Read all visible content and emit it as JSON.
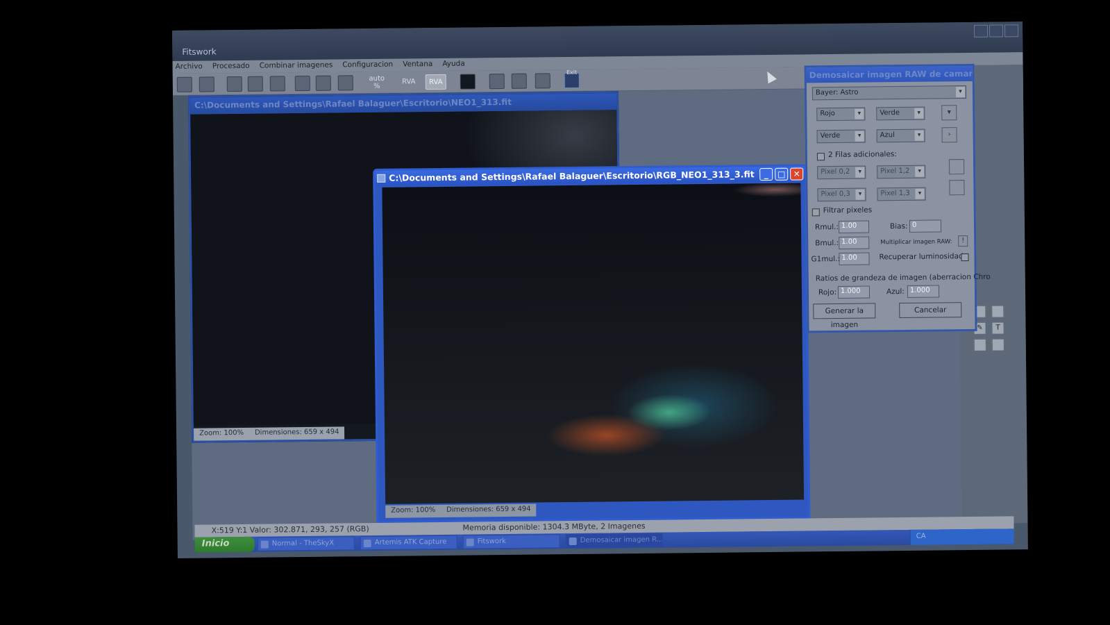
{
  "app": {
    "title": "Fitswork"
  },
  "menu": [
    "Archivo",
    "Procesado",
    "Combinar imagenes",
    "Configuracion",
    "Ventana",
    "Ayuda"
  ],
  "toolbar": {
    "auto_label": "auto\n%",
    "rva1": "RVA",
    "rva2": "RVA",
    "exit": "Exit"
  },
  "child1": {
    "title": "C:\\Documents and Settings\\Rafael Balaguer\\Escritorio\\NEO1_313.fit",
    "zoom": "Zoom: 100%",
    "dims": "Dimensiones: 659 x 494"
  },
  "child2": {
    "title": "C:\\Documents and Settings\\Rafael Balaguer\\Escritorio\\RGB_NEO1_313_3.fit",
    "zoom": "Zoom: 100%",
    "dims": "Dimensiones: 659 x 494"
  },
  "panel": {
    "title": "Demosaicar imagen RAW de camara",
    "preset": "Bayer: Astro",
    "grid": {
      "r1c1": "Rojo",
      "r1c2": "Verde",
      "r2c1": "Verde",
      "r2c2": "Azul"
    },
    "extra_rows_label": "2 Filas adicionales:",
    "pixels": {
      "p02": "Pixel 0,2",
      "p12": "Pixel 1,2",
      "p03": "Pixel 0,3",
      "p13": "Pixel 1,3"
    },
    "filter_label": "Filtrar pixeles",
    "rmul_label": "Rmul.:",
    "rmul": "1.00",
    "bias_label": "Bias:",
    "bias": "0",
    "bmul_label": "Bmul.:",
    "bmul": "1.00",
    "multiply_label": "Multiplicar imagen RAW:",
    "g1mul_label": "G1mul.:",
    "g1mul": "1.00",
    "recover_label": "Recuperar luminosidad",
    "ratios_label": "Ratios de grandeza de imagen (aberracion Chro",
    "rojo_label": "Rojo:",
    "rojo": "1.000",
    "azul_label": "Azul:",
    "azul": "1.000",
    "generate_btn": "Generar la imagen",
    "cancel_btn": "Cancelar"
  },
  "status": {
    "coords": "X:519 Y:1 Valor: 302.871, 293, 257 (RGB)",
    "memory": "Memoria disponible: 1304.3 MByte, 2 Imagenes"
  },
  "taskbar": {
    "start": "Inicio",
    "tasks": [
      "Normal - TheSkyX",
      "Artemis ATK Capture",
      "Fitswork",
      "Demosaicar imagen R..."
    ],
    "tray_lang": "CA"
  }
}
